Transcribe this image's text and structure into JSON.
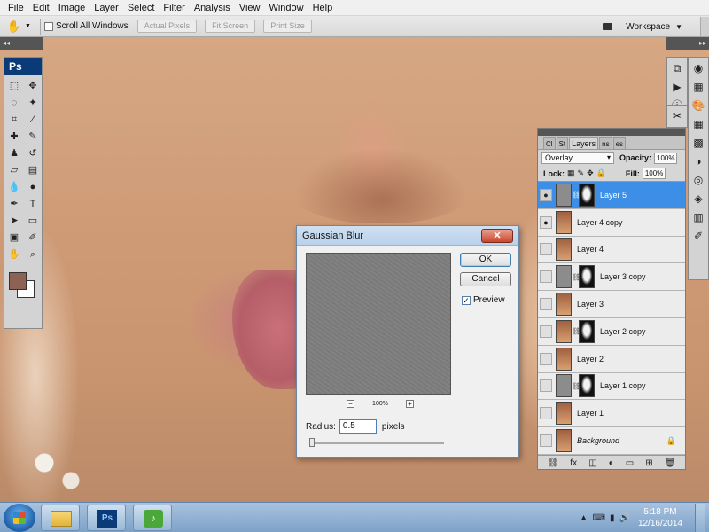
{
  "menu": [
    "File",
    "Edit",
    "Image",
    "Layer",
    "Select",
    "Filter",
    "Analysis",
    "View",
    "Window",
    "Help"
  ],
  "options": {
    "scroll_all_label": "Scroll All Windows",
    "actual_pixels": "Actual Pixels",
    "fit_screen": "Fit Screen",
    "print_size": "Print Size",
    "workspace": "Workspace"
  },
  "tools": {
    "logo": "Ps"
  },
  "dialog": {
    "title": "Gaussian Blur",
    "ok": "OK",
    "cancel": "Cancel",
    "preview": "Preview",
    "zoom": "100%",
    "radius_label": "Radius:",
    "radius_value": "0.5",
    "unit": "pixels"
  },
  "layers_panel": {
    "tabs": [
      "Cl",
      "St",
      "Layers",
      "ns",
      "es"
    ],
    "blend_mode": "Overlay",
    "opacity_label": "Opacity:",
    "opacity": "100%",
    "lock_label": "Lock:",
    "fill_label": "Fill:",
    "fill": "100%",
    "layers": [
      {
        "name": "Layer 5",
        "visible": true,
        "selected": true
      },
      {
        "name": "Layer 4 copy",
        "visible": true,
        "selected": false
      },
      {
        "name": "Layer 4",
        "visible": false,
        "selected": false
      },
      {
        "name": "Layer 3 copy",
        "visible": false,
        "selected": false
      },
      {
        "name": "Layer 3",
        "visible": false,
        "selected": false
      },
      {
        "name": "Layer 2 copy",
        "visible": false,
        "selected": false
      },
      {
        "name": "Layer 2",
        "visible": false,
        "selected": false
      },
      {
        "name": "Layer 1 copy",
        "visible": false,
        "selected": false
      },
      {
        "name": "Layer 1",
        "visible": false,
        "selected": false
      },
      {
        "name": "Background",
        "visible": false,
        "selected": false,
        "locked": true
      }
    ]
  },
  "taskbar": {
    "time": "5:18 PM",
    "date": "12/16/2014"
  },
  "colors": {
    "foreground": "#8c6253",
    "background": "#ffffff",
    "selection": "#3d8ee6"
  }
}
